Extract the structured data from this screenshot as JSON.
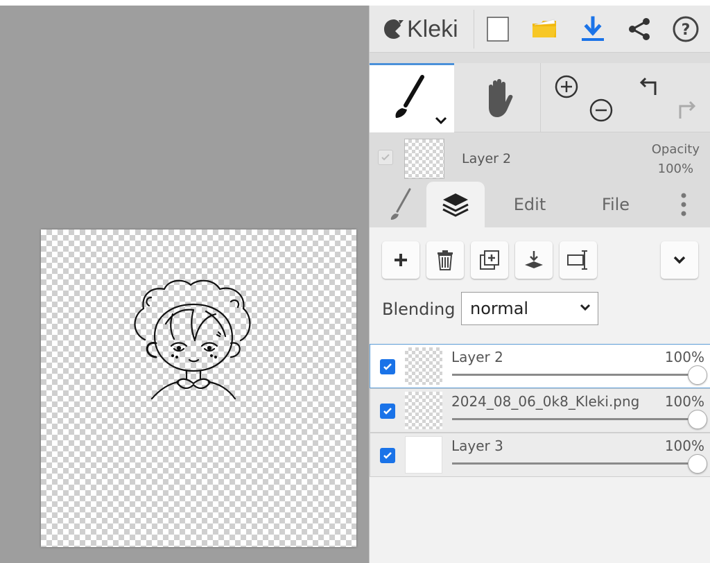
{
  "app": {
    "name": "Kleki",
    "brand_color": "#444444",
    "accent_color": "#1a73e8"
  },
  "header": {
    "buttons": [
      {
        "name": "new-document",
        "icon": "blank-page-icon"
      },
      {
        "name": "open",
        "icon": "folder-icon"
      },
      {
        "name": "download",
        "icon": "download-icon"
      },
      {
        "name": "share",
        "icon": "share-icon"
      },
      {
        "name": "help",
        "icon": "help-circle-icon"
      }
    ]
  },
  "tools": {
    "active": "brush",
    "items": [
      "brush",
      "hand",
      "zoom",
      "undo-redo"
    ]
  },
  "current_layer": {
    "name": "Layer 2",
    "opacity_label": "Opacity",
    "opacity_value": "100%"
  },
  "tabs": {
    "active": "layers",
    "edit": "Edit",
    "file": "File"
  },
  "layer_actions": [
    {
      "name": "add-layer",
      "icon": "plus-icon"
    },
    {
      "name": "delete-layer",
      "icon": "trash-icon"
    },
    {
      "name": "duplicate-layer",
      "icon": "duplicate-icon"
    },
    {
      "name": "merge-down",
      "icon": "merge-down-icon"
    },
    {
      "name": "rename-layer",
      "icon": "rename-icon"
    },
    {
      "name": "more-options",
      "icon": "chevron-down-icon"
    }
  ],
  "blending": {
    "label": "Blending",
    "value": "normal"
  },
  "layers": [
    {
      "name": "Layer 2",
      "opacity": "100%",
      "visible": true,
      "active": true
    },
    {
      "name": "2024_08_06_0k8_Kleki.png",
      "opacity": "100%",
      "visible": true,
      "active": false
    },
    {
      "name": "Layer 3",
      "opacity": "100%",
      "visible": true,
      "active": false
    }
  ]
}
